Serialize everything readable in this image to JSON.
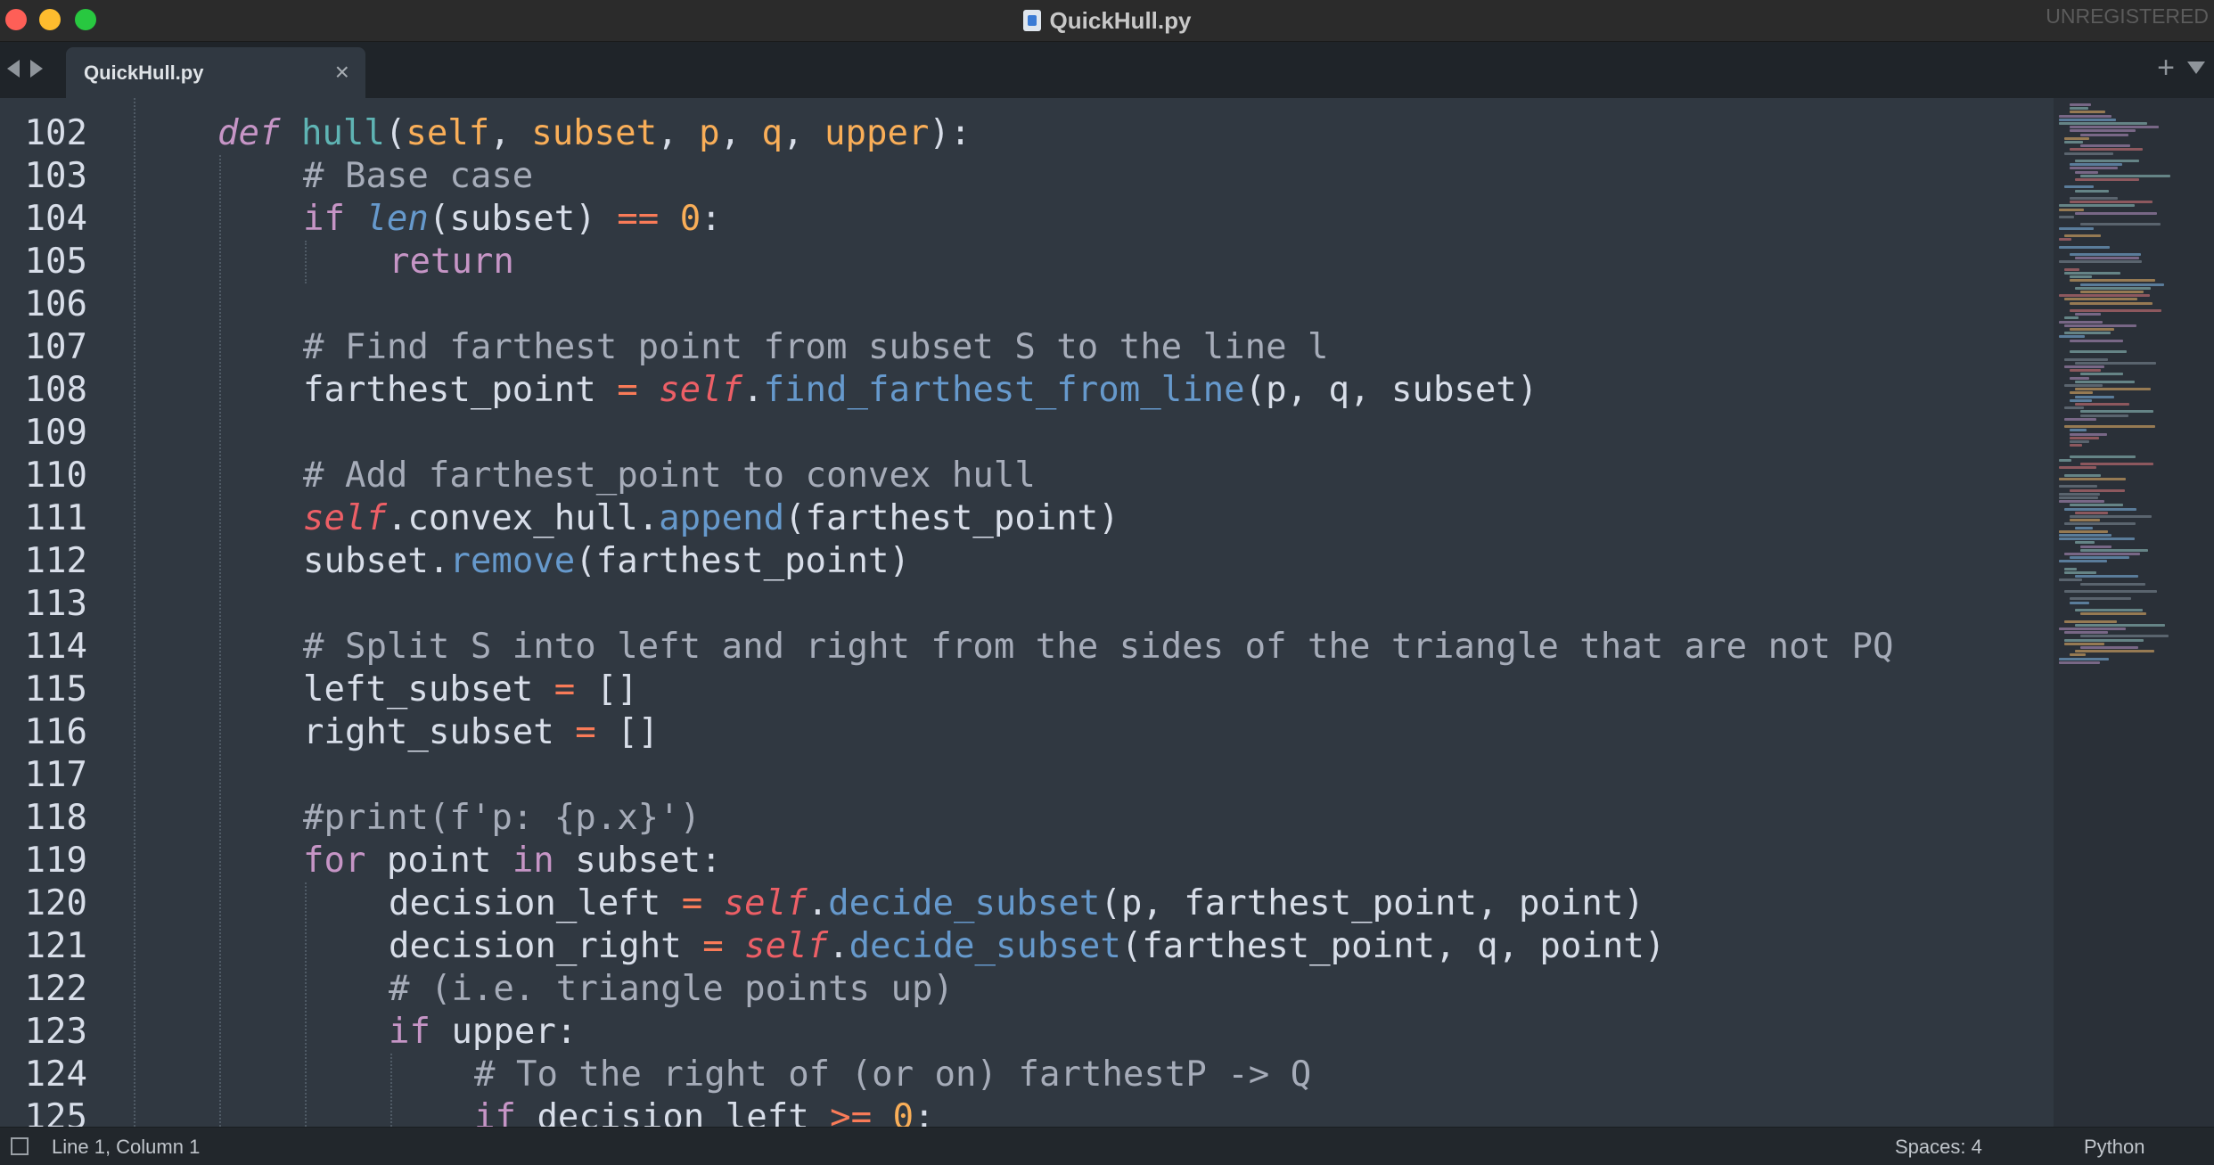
{
  "window": {
    "title": "QuickHull.py",
    "registration": "UNREGISTERED"
  },
  "tabs": [
    {
      "label": "QuickHull.py",
      "close_glyph": "×"
    }
  ],
  "tabbar": {
    "new_tab_glyph": "+"
  },
  "editor": {
    "line_numbers": [
      "102",
      "103",
      "104",
      "105",
      "106",
      "107",
      "108",
      "109",
      "110",
      "111",
      "112",
      "113",
      "114",
      "115",
      "116",
      "117",
      "118",
      "119",
      "120",
      "121",
      "122",
      "123",
      "124",
      "125"
    ]
  },
  "status": {
    "position": "Line 1, Column 1",
    "indentation": "Spaces: 4",
    "syntax": "Python"
  },
  "colors": {
    "background": "#303841",
    "keyword": "#c695c6",
    "function": "#5fb4b4",
    "self": "#ec5f66",
    "parameter": "#f9ae58",
    "operator": "#f97b58",
    "comment": "#a6acb9",
    "method": "#6699cc"
  }
}
